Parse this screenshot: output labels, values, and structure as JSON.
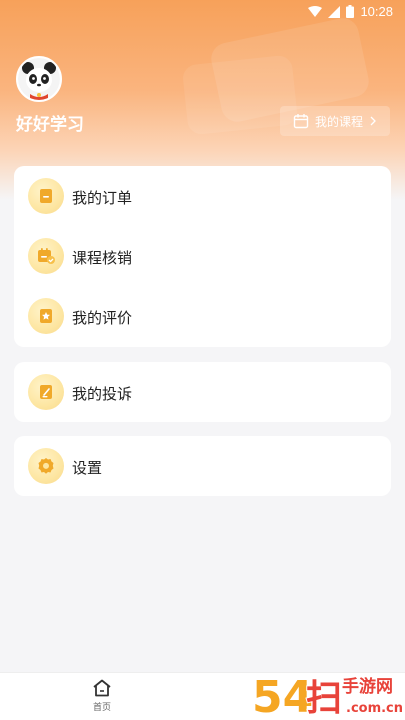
{
  "status_bar": {
    "time": "10:28"
  },
  "profile": {
    "username": "好好学习",
    "my_courses_label": "我的课程"
  },
  "menu_groups": [
    {
      "items": [
        {
          "label": "我的订单",
          "icon": "order-icon"
        },
        {
          "label": "课程核销",
          "icon": "course-verify-icon"
        },
        {
          "label": "我的评价",
          "icon": "review-icon"
        }
      ]
    },
    {
      "items": [
        {
          "label": "我的投诉",
          "icon": "complaint-icon"
        }
      ]
    },
    {
      "items": [
        {
          "label": "设置",
          "icon": "settings-icon"
        }
      ]
    }
  ],
  "tab_bar": {
    "home_label": "首页"
  },
  "watermark": {
    "text": "54扫手游网",
    "domain": ".com.cn"
  },
  "colors": {
    "accent": "#f7a15a",
    "icon_bg": "#fde6a2",
    "icon_fg": "#f0a92a"
  }
}
